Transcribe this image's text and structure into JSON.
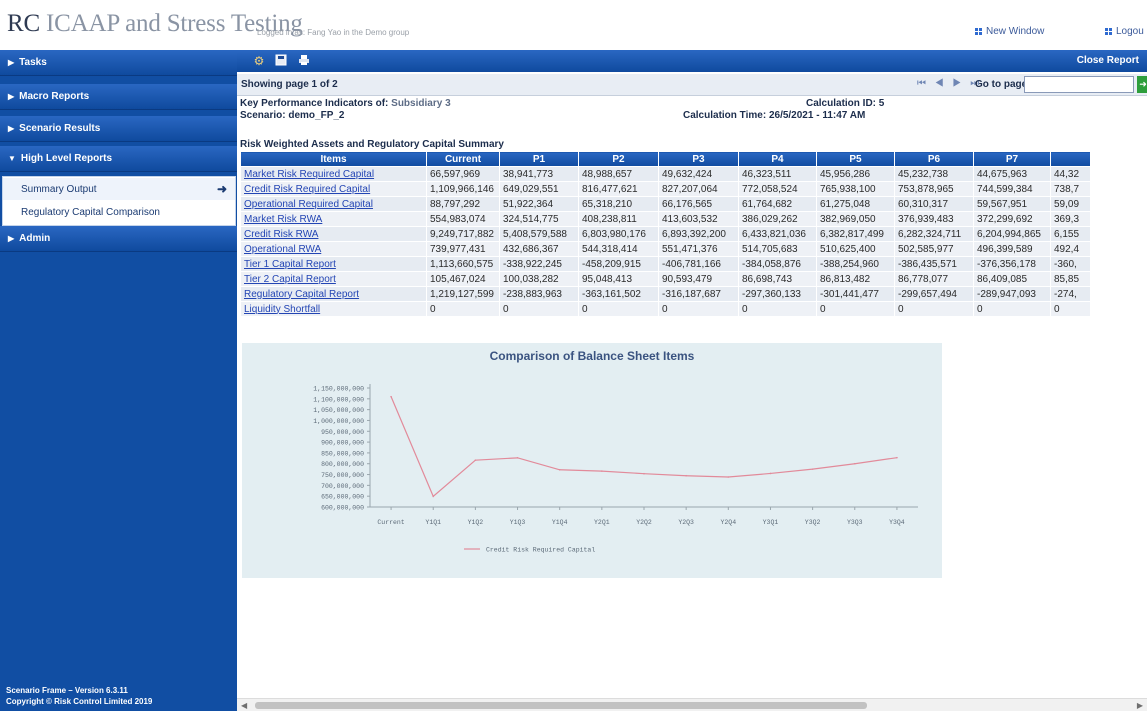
{
  "app": {
    "title_rc": "RC",
    "title_rest": "ICAAP and Stress Testing",
    "logged_in": "Logged in as: Fang Yao in the Demo group",
    "new_window": "New Window",
    "logout": "Logou"
  },
  "sidebar": {
    "items": [
      {
        "label": "Tasks",
        "arrow": "▶"
      },
      {
        "label": "Macro Reports",
        "arrow": "▶"
      },
      {
        "label": "Scenario Results",
        "arrow": "▶"
      },
      {
        "label": "High Level Reports",
        "arrow": "▼"
      },
      {
        "label": "Admin",
        "arrow": "▶"
      }
    ],
    "sub_items": [
      {
        "label": "Summary Output",
        "active": true
      },
      {
        "label": "Regulatory Capital Comparison",
        "active": false
      }
    ],
    "footer_line1": "Scenario Frame – Version 6.3.11",
    "footer_line2": "Copyright © Risk Control Limited 2019"
  },
  "toolbar": {
    "icons": [
      "gear-icon",
      "save-icon",
      "print-icon"
    ],
    "close_report": "Close Report"
  },
  "pager": {
    "showing": "Showing page 1 of 2",
    "nav": "◀| ◀ ▶ |▶",
    "goto_label": "Go to page:",
    "goto_value": "",
    "go_button": "➜"
  },
  "report": {
    "kpi_label": "Key Performance Indicators of:",
    "kpi_entity": "Subsidiary 3",
    "scenario": "Scenario: demo_FP_2",
    "calc_id": "Calculation ID: 5",
    "calc_time": "Calculation Time: 26/5/2021 - 11:47 AM",
    "section_title": "Risk Weighted Assets and Regulatory Capital Summary"
  },
  "table": {
    "headers": [
      "Items",
      "Current",
      "P1",
      "P2",
      "P3",
      "P4",
      "P5",
      "P6",
      "P7",
      ""
    ],
    "rows": [
      [
        "Market Risk Required Capital",
        "66,597,969",
        "38,941,773",
        "48,988,657",
        "49,632,424",
        "46,323,511",
        "45,956,286",
        "45,232,738",
        "44,675,963",
        "44,32"
      ],
      [
        "Credit Risk Required Capital",
        "1,109,966,146",
        "649,029,551",
        "816,477,621",
        "827,207,064",
        "772,058,524",
        "765,938,100",
        "753,878,965",
        "744,599,384",
        "738,7"
      ],
      [
        "Operational Required Capital",
        "88,797,292",
        "51,922,364",
        "65,318,210",
        "66,176,565",
        "61,764,682",
        "61,275,048",
        "60,310,317",
        "59,567,951",
        "59,09"
      ],
      [
        "Market Risk RWA",
        "554,983,074",
        "324,514,775",
        "408,238,811",
        "413,603,532",
        "386,029,262",
        "382,969,050",
        "376,939,483",
        "372,299,692",
        "369,3"
      ],
      [
        "Credit Risk RWA",
        "9,249,717,882",
        "5,408,579,588",
        "6,803,980,176",
        "6,893,392,200",
        "6,433,821,036",
        "6,382,817,499",
        "6,282,324,711",
        "6,204,994,865",
        "6,155"
      ],
      [
        "Operational RWA",
        "739,977,431",
        "432,686,367",
        "544,318,414",
        "551,471,376",
        "514,705,683",
        "510,625,400",
        "502,585,977",
        "496,399,589",
        "492,4"
      ],
      [
        "Tier 1 Capital Report",
        "1,113,660,575",
        "-338,922,245",
        "-458,209,915",
        "-406,781,166",
        "-384,058,876",
        "-388,254,960",
        "-386,435,571",
        "-376,356,178",
        "-360,"
      ],
      [
        "Tier 2 Capital Report",
        "105,467,024",
        "100,038,282",
        "95,048,413",
        "90,593,479",
        "86,698,743",
        "86,813,482",
        "86,778,077",
        "86,409,085",
        "85,85"
      ],
      [
        "Regulatory Capital Report",
        "1,219,127,599",
        "-238,883,963",
        "-363,161,502",
        "-316,187,687",
        "-297,360,133",
        "-301,441,477",
        "-299,657,494",
        "-289,947,093",
        "-274,"
      ],
      [
        "Liquidity Shortfall",
        "0",
        "0",
        "0",
        "0",
        "0",
        "0",
        "0",
        "0",
        "0"
      ]
    ]
  },
  "chart_data": {
    "type": "line",
    "title": "Comparison of Balance Sheet Items",
    "categories": [
      "Current",
      "Y1Q1",
      "Y1Q2",
      "Y1Q3",
      "Y1Q4",
      "Y2Q1",
      "Y2Q2",
      "Y2Q3",
      "Y2Q4",
      "Y3Q1",
      "Y3Q2",
      "Y3Q3",
      "Y3Q4"
    ],
    "series": [
      {
        "name": "Credit Risk Required Capital",
        "color": "#e28a9a",
        "values": [
          1109966146,
          649029551,
          816477621,
          827207064,
          772058524,
          765938100,
          753878965,
          744599384,
          738700000,
          755000000,
          775000000,
          800000000,
          828000000
        ]
      }
    ],
    "ylim": [
      600000000,
      1150000000
    ],
    "yticks": [
      "1,150,000,000",
      "1,100,000,000",
      "1,050,000,000",
      "1,000,000,000",
      "950,000,000",
      "900,000,000",
      "850,000,000",
      "800,000,000",
      "750,000,000",
      "700,000,000",
      "650,000,000",
      "600,000,000"
    ],
    "legend": "bottom-center",
    "grid": false
  }
}
